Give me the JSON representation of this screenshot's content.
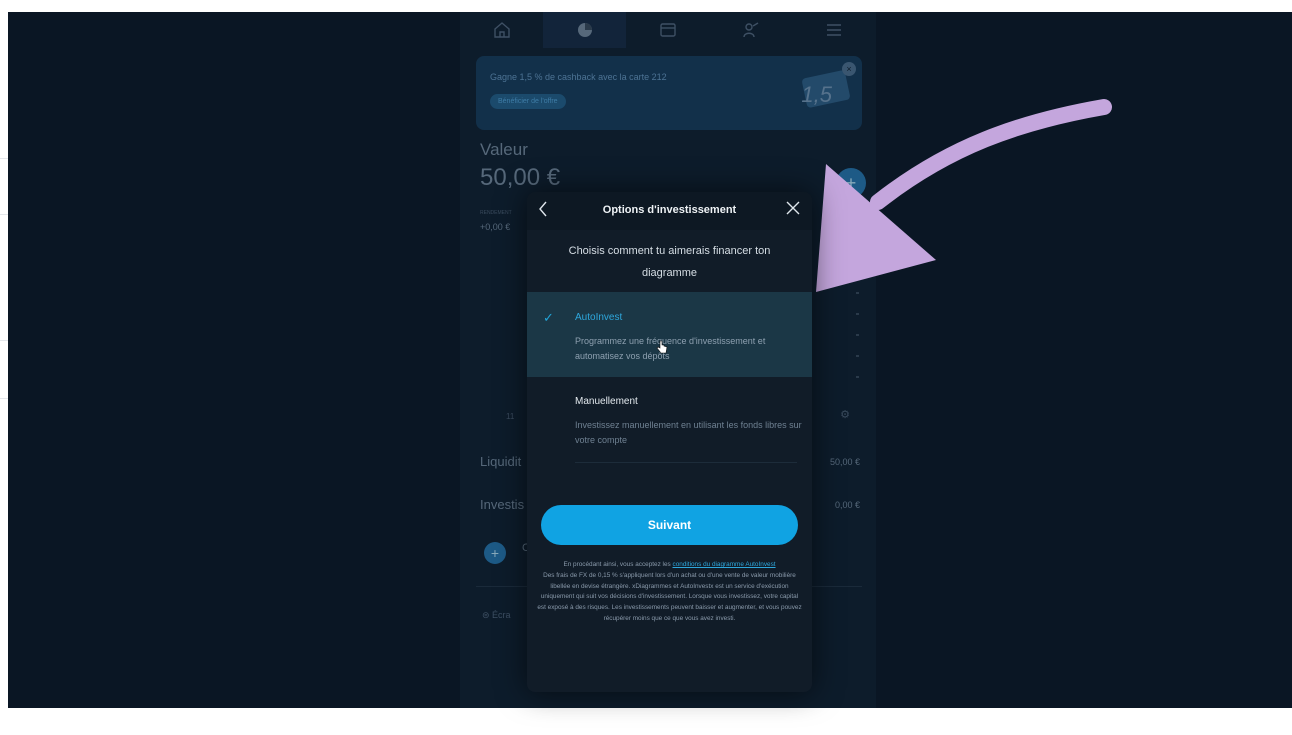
{
  "topnav": {
    "items": [
      {
        "icon": "home-icon"
      },
      {
        "icon": "pie-chart-icon",
        "active": true
      },
      {
        "icon": "card-icon"
      },
      {
        "icon": "people-icon"
      },
      {
        "icon": "menu-icon"
      }
    ]
  },
  "banner": {
    "text": "Gagne 1,5 % de cashback avec la carte 212",
    "button": "Bénéficier de l'offre",
    "card_number": "1,5",
    "close": "×"
  },
  "portfolio": {
    "value_label": "Valeur",
    "value_amount": "50,00 €",
    "performance_label": "RENDEMENT",
    "performance_value": "+0,00 €",
    "fab": "+"
  },
  "chart_tab": {
    "left": "11",
    "gear": "⚙"
  },
  "rows": {
    "liquidity_label": "Liquidit",
    "liquidity_amount": "50,00 €",
    "invest_label": "Investis",
    "invest_amount": "0,00 €",
    "add_plus": "+",
    "add_letter": "C",
    "screen_label": "Écra"
  },
  "modal": {
    "back": "‹",
    "title": "Options d'investissement",
    "close": "✕",
    "subtitle": "Choisis comment tu aimerais financer ton diagramme",
    "options": [
      {
        "title": "AutoInvest",
        "description": "Programmez une fréquence d'investissement et automatisez vos dépôts",
        "selected": true
      },
      {
        "title": "Manuellement",
        "description": "Investissez manuellement en utilisant les fonds libres sur votre compte",
        "selected": false
      }
    ],
    "check": "✓",
    "next_button": "Suivant",
    "legal": {
      "intro": "En procédant ainsi, vous acceptez les",
      "link": "conditions du diagramme AutoInvest",
      "body": "Des frais de FX de 0,15 % s'appliquent lors d'un achat ou d'une vente de valeur mobilière libellée en devise étrangère. xDiagrammes et AutoInvestx est un service d'exécution uniquement qui suit vos décisions d'investissement. Lorsque vous investissez, votre capital est exposé à des risques. Les investissements peuvent baisser et augmenter, et vous pouvez récupérer moins que ce que vous avez investi."
    }
  },
  "colors": {
    "background": "#0a1624",
    "accent": "#10a3e3",
    "arrow": "#c4a6dd",
    "selected_option": "#1b3746"
  }
}
